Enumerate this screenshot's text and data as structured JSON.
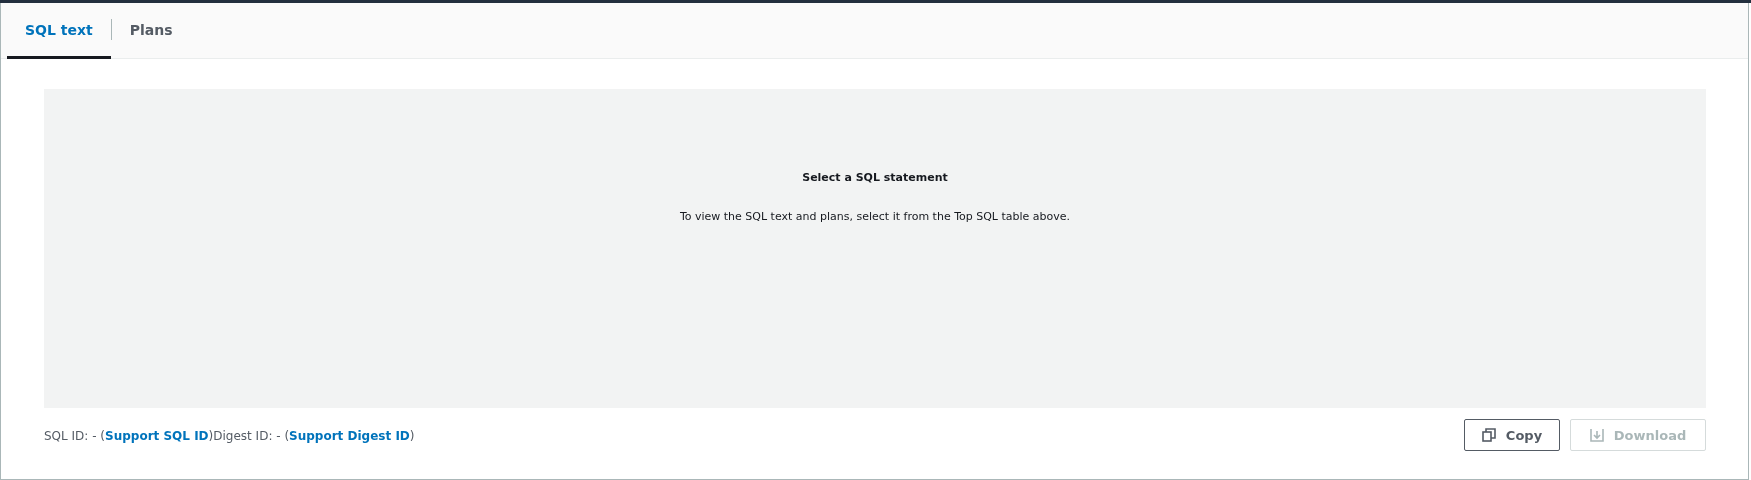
{
  "tabs": [
    {
      "label": "SQL text",
      "selected": true
    },
    {
      "label": "Plans",
      "selected": false
    }
  ],
  "empty_state": {
    "title": "Select a SQL statement",
    "message": "To view the SQL text and plans, select it from the Top SQL table above."
  },
  "footer": [
    {
      "kind": "text",
      "text": "SQL ID: - ("
    },
    {
      "kind": "link",
      "text": "Support SQL ID"
    },
    {
      "kind": "text",
      "text": ")Digest ID: - ("
    },
    {
      "kind": "link",
      "text": "Support Digest ID"
    },
    {
      "kind": "text",
      "text": ")"
    }
  ],
  "buttons": [
    {
      "kind": "copy",
      "label": "Copy",
      "disabled": false
    },
    {
      "kind": "download",
      "label": "Download",
      "disabled": true
    }
  ]
}
